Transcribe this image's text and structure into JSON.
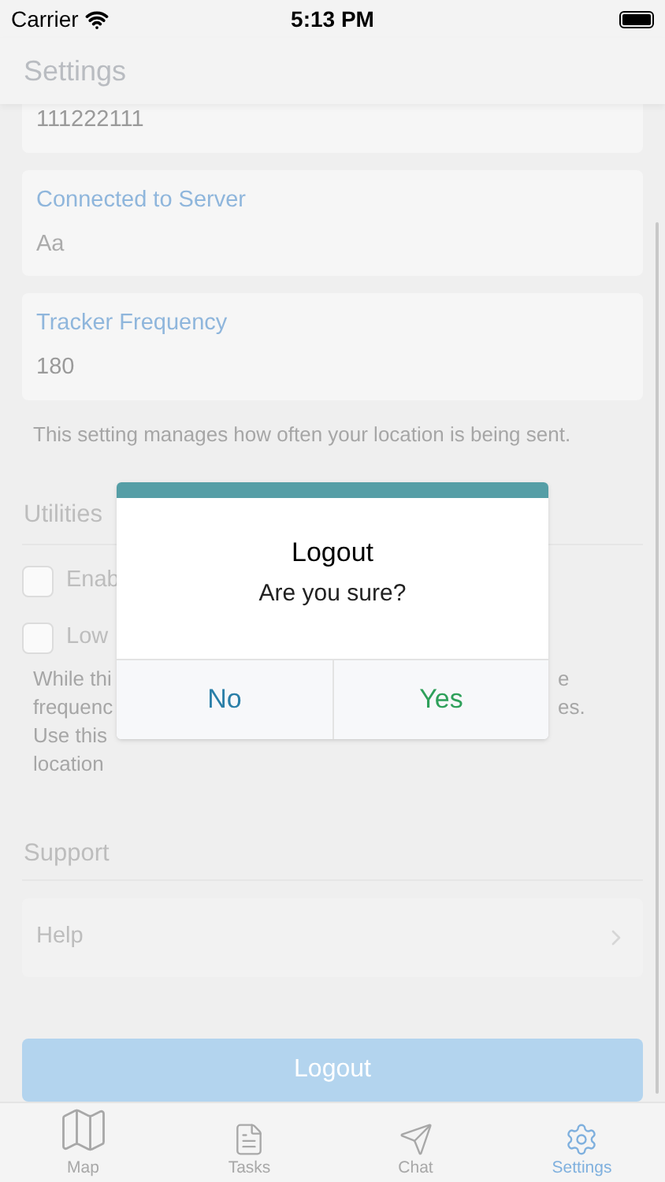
{
  "status_bar": {
    "carrier": "Carrier",
    "time": "5:13 PM"
  },
  "header": {
    "title": "Settings"
  },
  "fields": [
    {
      "value": "111222111"
    },
    {
      "label": "Connected to Server",
      "placeholder": "Aa"
    },
    {
      "label": "Tracker Frequency",
      "value": "180"
    }
  ],
  "hint": "This setting manages how often your location is being sent.",
  "utilities": {
    "title": "Utilities",
    "options": [
      {
        "label": "Enab",
        "checked": false
      },
      {
        "label": "Low",
        "checked": false
      }
    ],
    "note_lines": [
      {
        "left": "While thi",
        "right": "e"
      },
      {
        "left": "frequenc",
        "right": "es."
      },
      {
        "left": "Use this"
      },
      {
        "left": "location"
      }
    ]
  },
  "support": {
    "title": "Support",
    "items": [
      {
        "label": "Help"
      }
    ]
  },
  "logout_button": "Logout",
  "tabs": [
    {
      "label": "Map",
      "kind": "map",
      "selected": false
    },
    {
      "label": "Tasks",
      "kind": "tasks",
      "selected": false
    },
    {
      "label": "Chat",
      "kind": "chat",
      "selected": false
    },
    {
      "label": "Settings",
      "kind": "settings",
      "selected": true
    }
  ],
  "dialog": {
    "title": "Logout",
    "message": "Are you sure?",
    "buttons": [
      {
        "label": "No",
        "kind": "cancel"
      },
      {
        "label": "Yes",
        "kind": "confirm"
      }
    ]
  }
}
